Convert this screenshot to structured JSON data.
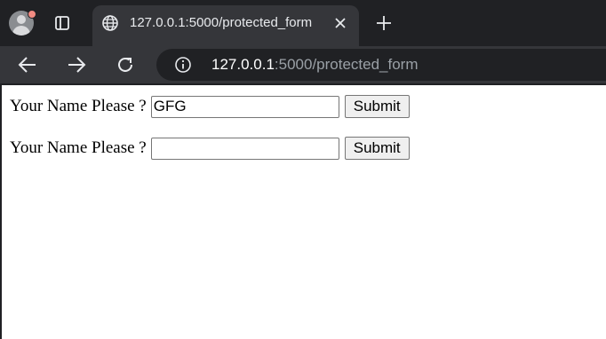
{
  "browser": {
    "tab": {
      "title": "127.0.0.1:5000/protected_form"
    },
    "address_bar": {
      "host": "127.0.0.1",
      "rest": ":5000/protected_form"
    }
  },
  "page": {
    "forms": [
      {
        "label": "Your Name Please ?",
        "value": "GFG",
        "button": "Submit"
      },
      {
        "label": "Your Name Please ?",
        "value": "",
        "button": "Submit"
      }
    ]
  }
}
